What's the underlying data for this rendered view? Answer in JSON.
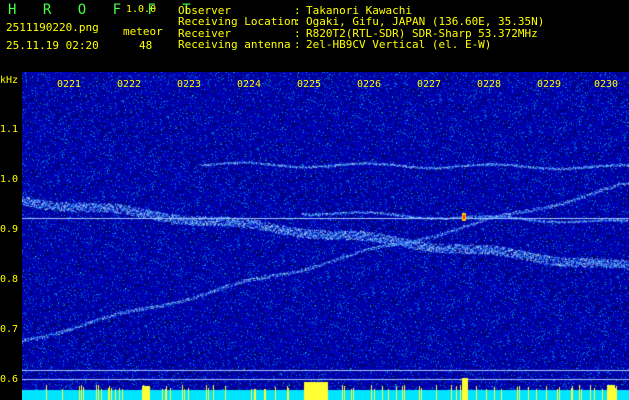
{
  "app": {
    "logo": "H R O F F T",
    "version": "1.0.0"
  },
  "file": {
    "name": "2511190220.png",
    "datetime": "25.11.19 02:20"
  },
  "meteor": {
    "label": "meteor",
    "count": "48"
  },
  "info": [
    {
      "key": "Observer",
      "sep": ":",
      "value": "Takanori Kawachi"
    },
    {
      "key": "Receiving Location",
      "sep": ":",
      "value": "Ogaki, Gifu, JAPAN (136.60E, 35.35N)"
    },
    {
      "key": "Receiver",
      "sep": ":",
      "value": "R820T2(RTL-SDR) SDR-Sharp 53.372MHz"
    },
    {
      "key": "Receiving antenna",
      "sep": ":",
      "value": "2el-HB9CV Vertical (el. E-W)"
    }
  ],
  "axis": {
    "y_unit": "kHz",
    "y_ticks": [
      "1.1",
      "1.0",
      "0.9",
      "0.8",
      "0.7",
      "0.6"
    ],
    "x_ticks": [
      "0221",
      "0222",
      "0223",
      "0224",
      "0225",
      "0226",
      "0227",
      "0228",
      "0229",
      "0230"
    ]
  },
  "colors": {
    "background": "#000000",
    "waterfall_base": "#00008a",
    "text_green": "#44ff44",
    "text_yellow": "#ffff00",
    "marker_line": "#9ec4ff",
    "bottom_bar": "#00e5ff"
  }
}
